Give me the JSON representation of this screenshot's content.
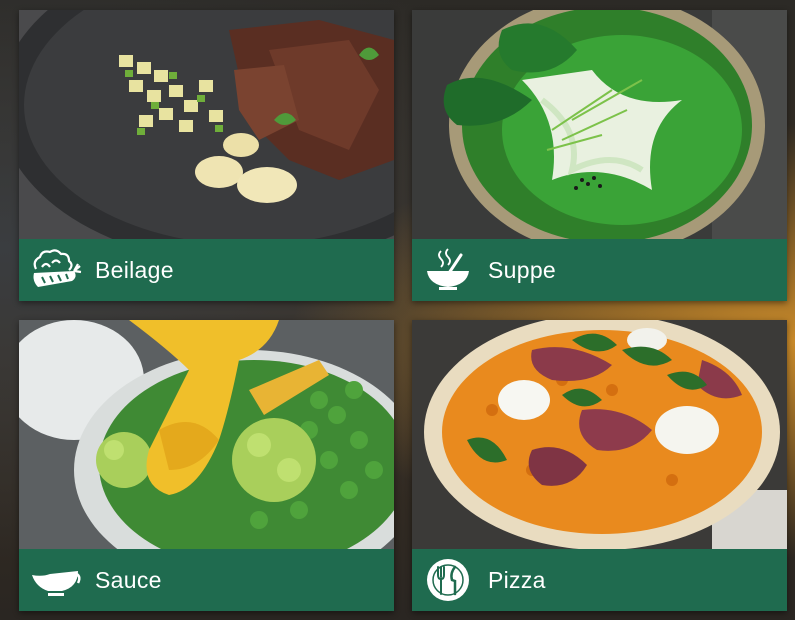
{
  "tiles": [
    {
      "label": "Beilage",
      "icon": "vegetables-icon"
    },
    {
      "label": "Suppe",
      "icon": "soup-bowl-icon"
    },
    {
      "label": "Sauce",
      "icon": "gravy-boat-icon"
    },
    {
      "label": "Pizza",
      "icon": "plate-cutlery-icon"
    }
  ],
  "colors": {
    "label_bar": "#1f6b4f",
    "label_text": "#ffffff"
  }
}
